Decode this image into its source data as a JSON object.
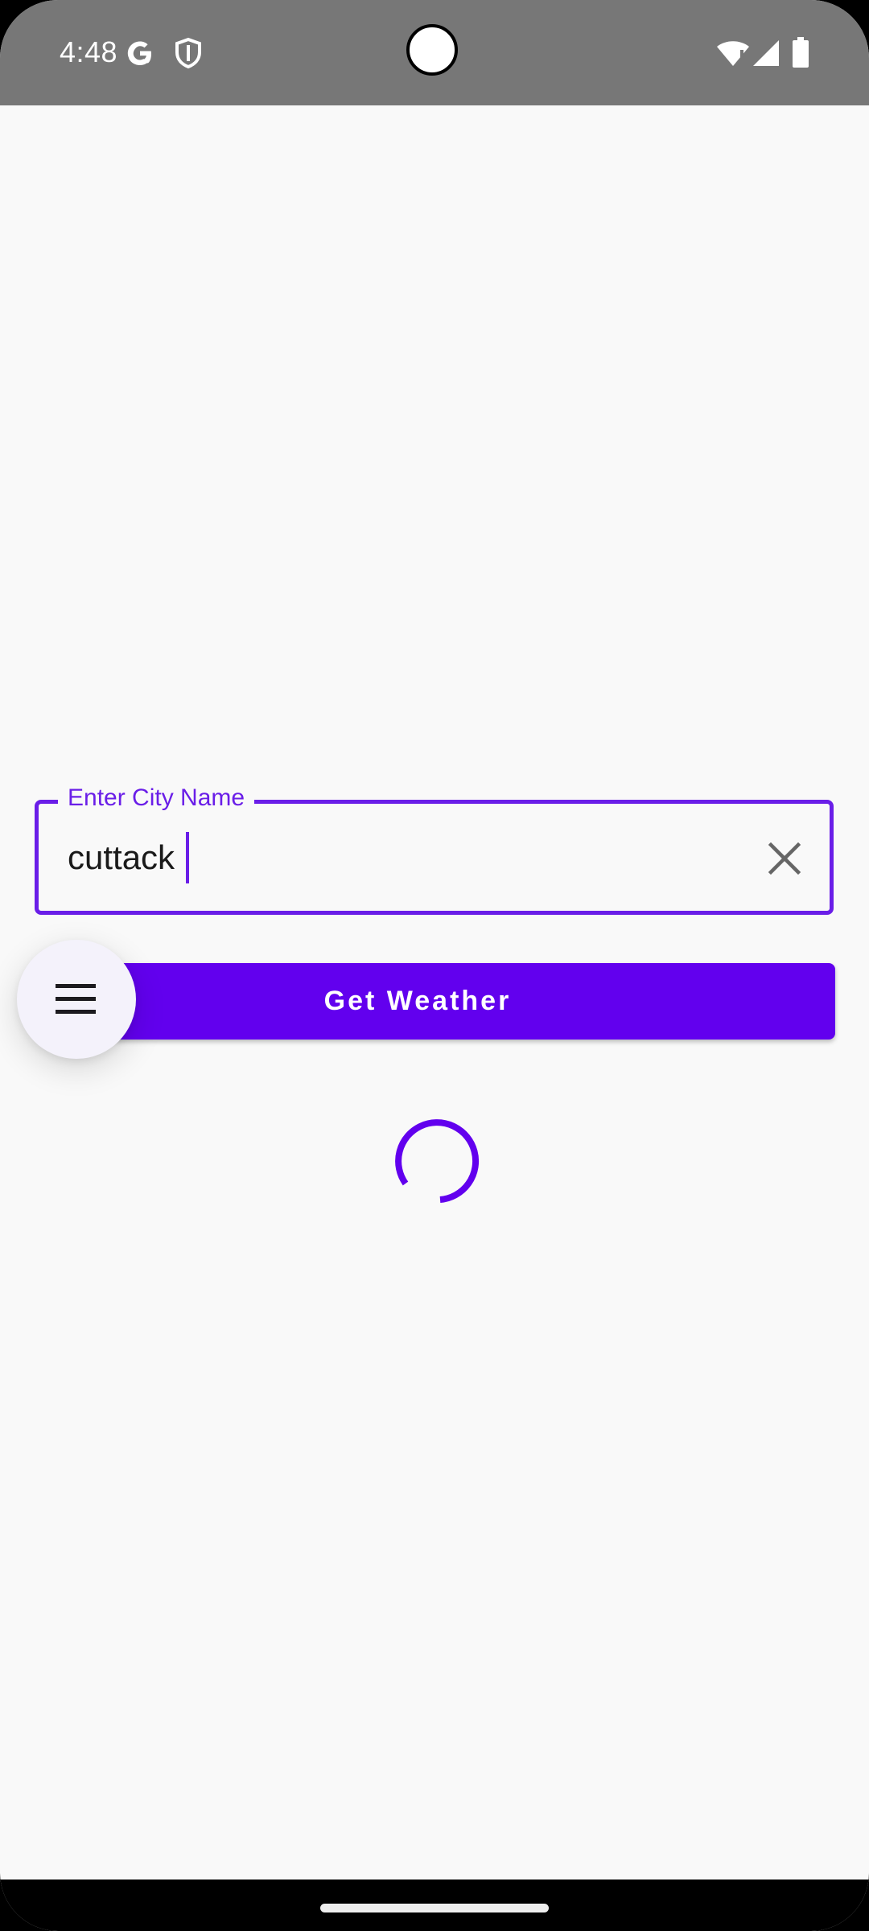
{
  "status_bar": {
    "time": "4:48",
    "icons": [
      "google-g-icon",
      "shield-icon",
      "wifi-icon",
      "signal-icon",
      "battery-icon"
    ]
  },
  "city_field": {
    "label": "Enter City Name",
    "value": "cuttack",
    "clear_icon": "close-icon"
  },
  "get_weather_button": {
    "label": "Get Weather"
  },
  "fab": {
    "icon": "menu-icon"
  },
  "loading": {
    "icon": "progress-spinner-icon"
  },
  "colors": {
    "accent": "#6200ee",
    "outline": "#6a1ee8",
    "background": "#f9f9f9",
    "status_bar": "#777777"
  }
}
